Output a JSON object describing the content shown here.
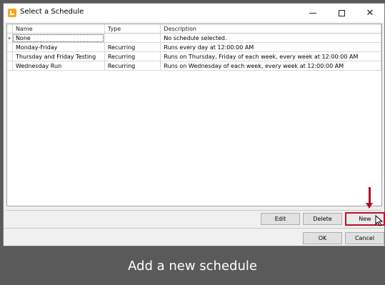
{
  "window": {
    "title": "Select a Schedule",
    "icon": "app-icon",
    "controls": {
      "minimize": "–",
      "maximize": "□",
      "close": "✕"
    }
  },
  "grid": {
    "columns": [
      "Name",
      "Type",
      "Description"
    ],
    "rows": [
      {
        "indicator": "▸",
        "name": "None",
        "type": "",
        "description": "No schedule selected."
      },
      {
        "indicator": "",
        "name": "Monday-Friday",
        "type": "Recurring",
        "description": "Runs every day at 12:00:00 AM"
      },
      {
        "indicator": "",
        "name": "Thursday and Friday Testing",
        "type": "Recurring",
        "description": "Runs on Thursday, Friday of each week, every week at 12:00:00 AM"
      },
      {
        "indicator": "",
        "name": "Wednesday Run",
        "type": "Recurring",
        "description": "Runs on Wednesday of each week, every week at 12:00:00 AM"
      }
    ]
  },
  "buttons": {
    "edit": "Edit",
    "delete": "Delete",
    "new": "New",
    "ok": "OK",
    "cancel": "Cancel"
  },
  "caption": "Add a new schedule",
  "colors": {
    "highlight": "#c0102a",
    "caption_bg": "#5a5a5a"
  }
}
